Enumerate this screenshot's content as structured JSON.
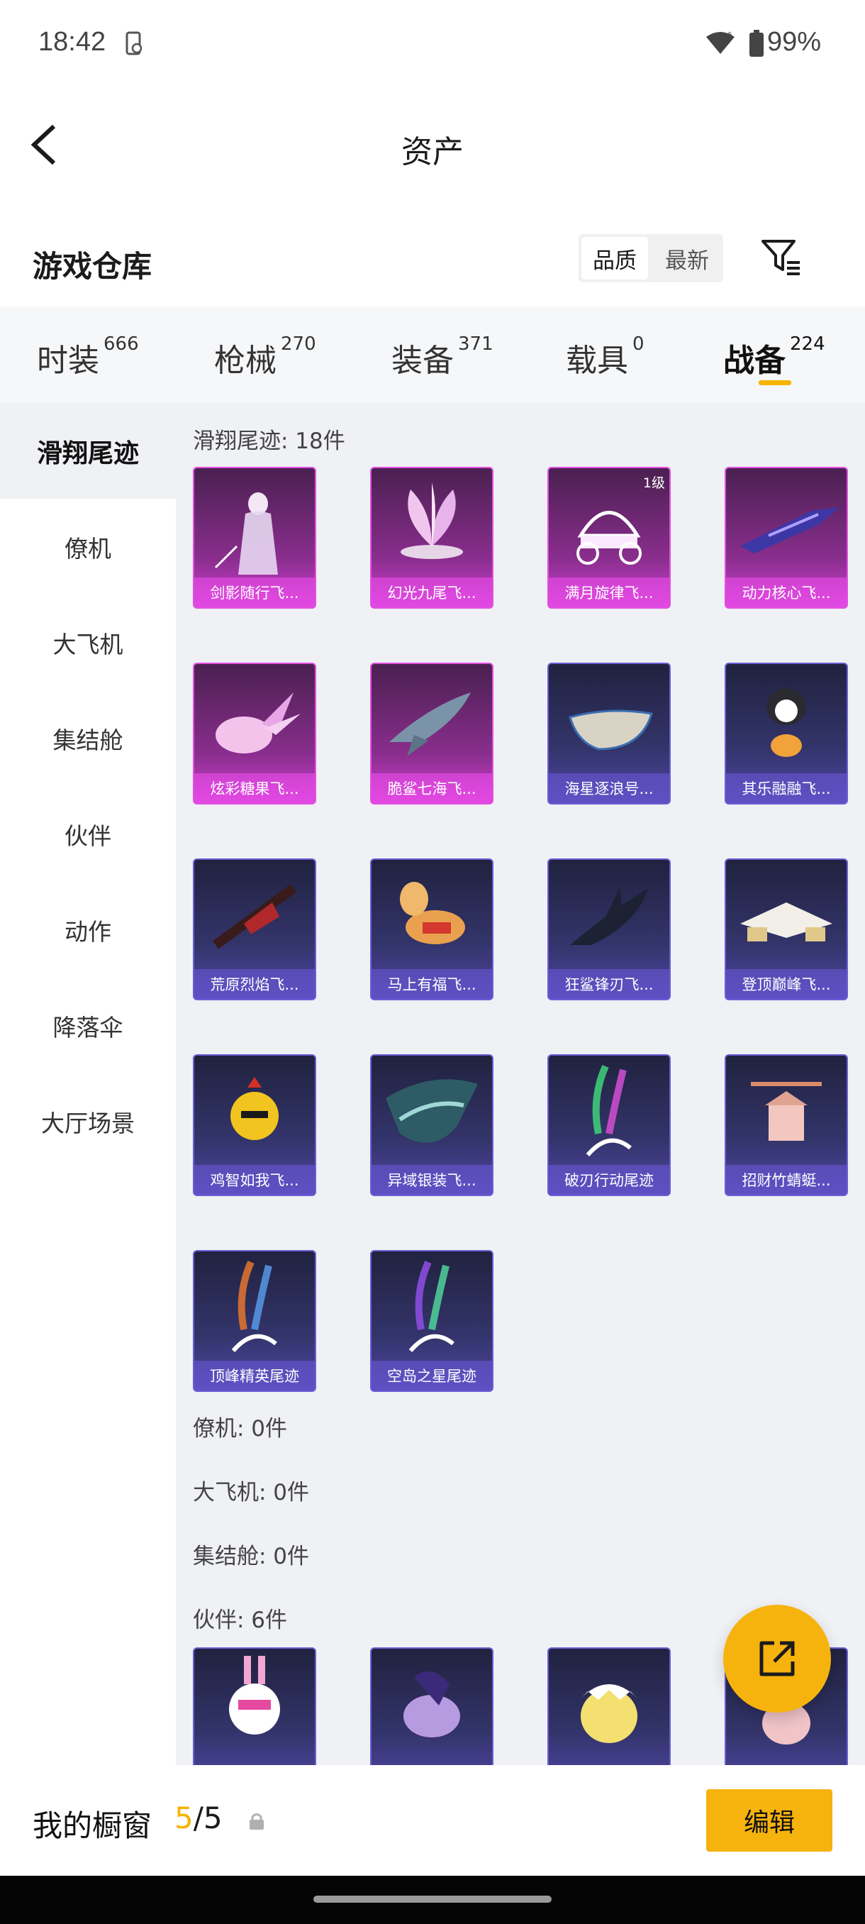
{
  "status_bar": {
    "time": "18:42",
    "battery": "99%"
  },
  "header": {
    "title": "资产"
  },
  "warehouse": {
    "title": "游戏仓库",
    "sort_options": [
      "品质",
      "最新"
    ],
    "active_sort": "品质"
  },
  "tabs": [
    {
      "label": "时装",
      "count": "666"
    },
    {
      "label": "枪械",
      "count": "270"
    },
    {
      "label": "装备",
      "count": "371"
    },
    {
      "label": "载具",
      "count": "0"
    },
    {
      "label": "战备",
      "count": "224",
      "active": true
    }
  ],
  "sidebar": {
    "items": [
      {
        "label": "滑翔尾迹",
        "active": true
      },
      {
        "label": "僚机"
      },
      {
        "label": "大飞机"
      },
      {
        "label": "集结舱"
      },
      {
        "label": "伙伴"
      },
      {
        "label": "动作"
      },
      {
        "label": "降落伞"
      },
      {
        "label": "大厅场景"
      }
    ]
  },
  "content": {
    "sections": {
      "glide": "滑翔尾迹: 18件",
      "wingman": "僚机: 0件",
      "big_plane": "大飞机: 0件",
      "capsule": "集结舱: 0件",
      "partner": "伙伴: 6件"
    },
    "glide_items": [
      {
        "name": "剑影随行飞...",
        "rarity": "pink",
        "icon": "swordswoman-figure"
      },
      {
        "name": "幻光九尾飞...",
        "rarity": "pink",
        "icon": "nine-tail-flower"
      },
      {
        "name": "满月旋律飞...",
        "rarity": "pink",
        "icon": "carriage",
        "badge": "1级"
      },
      {
        "name": "动力核心飞...",
        "rarity": "pink",
        "icon": "power-glider"
      },
      {
        "name": "炫彩糖果飞...",
        "rarity": "pink",
        "icon": "candy-glider"
      },
      {
        "name": "脆鲨七海飞...",
        "rarity": "pink",
        "icon": "shark-glider"
      },
      {
        "name": "海星逐浪号...",
        "rarity": "blue",
        "icon": "boat"
      },
      {
        "name": "其乐融融飞...",
        "rarity": "blue",
        "icon": "penguin"
      },
      {
        "name": "荒原烈焰飞...",
        "rarity": "blue",
        "icon": "flame-glider"
      },
      {
        "name": "马上有福飞...",
        "rarity": "blue",
        "icon": "horse-toy"
      },
      {
        "name": "狂鲨锋刃飞...",
        "rarity": "blue",
        "icon": "blade-shark"
      },
      {
        "name": "登顶巅峰飞...",
        "rarity": "blue",
        "icon": "jet-glider"
      },
      {
        "name": "鸡智如我飞...",
        "rarity": "blue",
        "icon": "chicken"
      },
      {
        "name": "异域银装飞...",
        "rarity": "blue",
        "icon": "silver-wings"
      },
      {
        "name": "破刃行动尾迹",
        "rarity": "blue",
        "icon": "smoke-trail"
      },
      {
        "name": "招财竹蜻蜓...",
        "rarity": "blue",
        "icon": "bamboo-copter"
      },
      {
        "name": "顶峰精英尾迹",
        "rarity": "blue",
        "icon": "smoke-trail"
      },
      {
        "name": "空岛之星尾迹",
        "rarity": "blue",
        "icon": "smoke-trail"
      }
    ],
    "partner_items": [
      {
        "icon": "bunny-robot"
      },
      {
        "icon": "purple-pony"
      },
      {
        "icon": "egg-chick"
      },
      {
        "icon": "pink-creature"
      }
    ]
  },
  "showcase": {
    "title": "我的橱窗",
    "current": "5",
    "separator": "/",
    "total": "5",
    "edit_label": "编辑"
  },
  "colors": {
    "accent": "#f7b30d",
    "pink_rarity": "#e24fe0",
    "blue_rarity": "#6a5ed6"
  }
}
